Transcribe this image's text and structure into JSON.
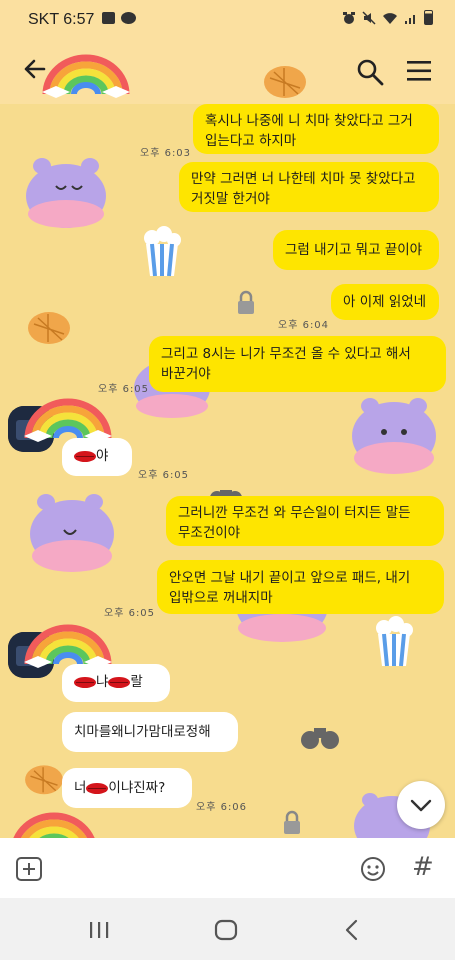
{
  "status": {
    "carrier_time": "SKT 6:57",
    "icons": [
      "image-icon",
      "talk-icon",
      "alarm-icon",
      "mute-icon",
      "wifi-icon",
      "signal-icon",
      "battery-icon"
    ]
  },
  "appbar": {
    "back": "back-arrow-icon",
    "logo": "rainbow-logo",
    "search": "search-icon",
    "menu": "menu-icon"
  },
  "messages": [
    {
      "side": "out",
      "lines": [
        "혹시나 나중에 니 치마 찾았다고 그거",
        "입는다고 하지마"
      ],
      "time": "오후 6:03"
    },
    {
      "side": "out",
      "lines": [
        "만약 그러면 너 나한테 치마 못 찾았다고",
        "거짓말 한거야"
      ]
    },
    {
      "side": "out",
      "lines": [
        "그럼 내기고 뭐고 끝이야"
      ]
    },
    {
      "side": "out",
      "lines": [
        "아 이제 읽었네"
      ],
      "time": "오후 6:04"
    },
    {
      "side": "out",
      "lines": [
        "그리고 8시는 니가 무조건 올 수 있다고 해서",
        "바꾼거야"
      ],
      "time": "오후 6:05"
    },
    {
      "side": "in",
      "text_after_lips": "야",
      "time": "오후 6:05"
    },
    {
      "side": "out",
      "lines": [
        "그러니깐 무조건 와 무슨일이 터지든 말든",
        "무조건이야"
      ]
    },
    {
      "side": "out",
      "lines": [
        "안오면 그날 내기 끝이고 앞으로 패드, 내기",
        "입밖으로 꺼내지마"
      ],
      "time": "오후 6:05"
    },
    {
      "side": "in",
      "text_middle": "냐",
      "text_after": "랄"
    },
    {
      "side": "in",
      "text": "치마를왜니가맘대로정해"
    },
    {
      "side": "in",
      "text_before": "너",
      "text_after": "이냐진짜?",
      "time": "오후 6:06"
    }
  ],
  "input": {
    "plus": "plus-icon",
    "emoji": "emoji-icon",
    "hash": "#"
  },
  "nav": [
    "recent-apps-icon",
    "home-icon",
    "back-icon"
  ]
}
